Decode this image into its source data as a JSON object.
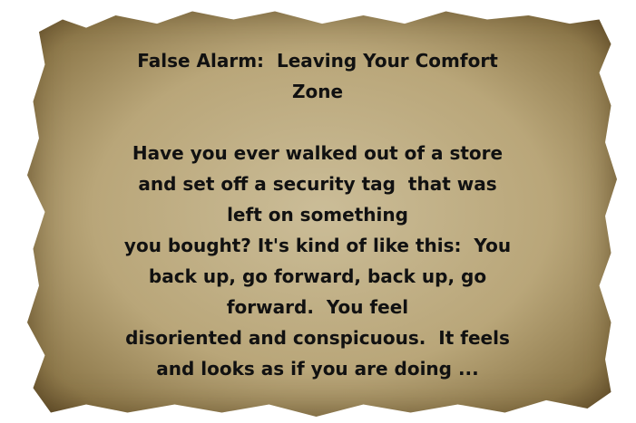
{
  "title_lines": [
    "False Alarm:  Leaving Your Comfort",
    "Zone"
  ],
  "body_lines": [
    "Have you ever walked out of a store",
    "and set off a security tag  that was",
    "left on something",
    "you bought? It's kind of like this:  You",
    "back up, go forward, back up, go",
    "forward.  You feel",
    "disoriented and conspicuous.  It feels",
    "and looks as if you are doing ..."
  ]
}
